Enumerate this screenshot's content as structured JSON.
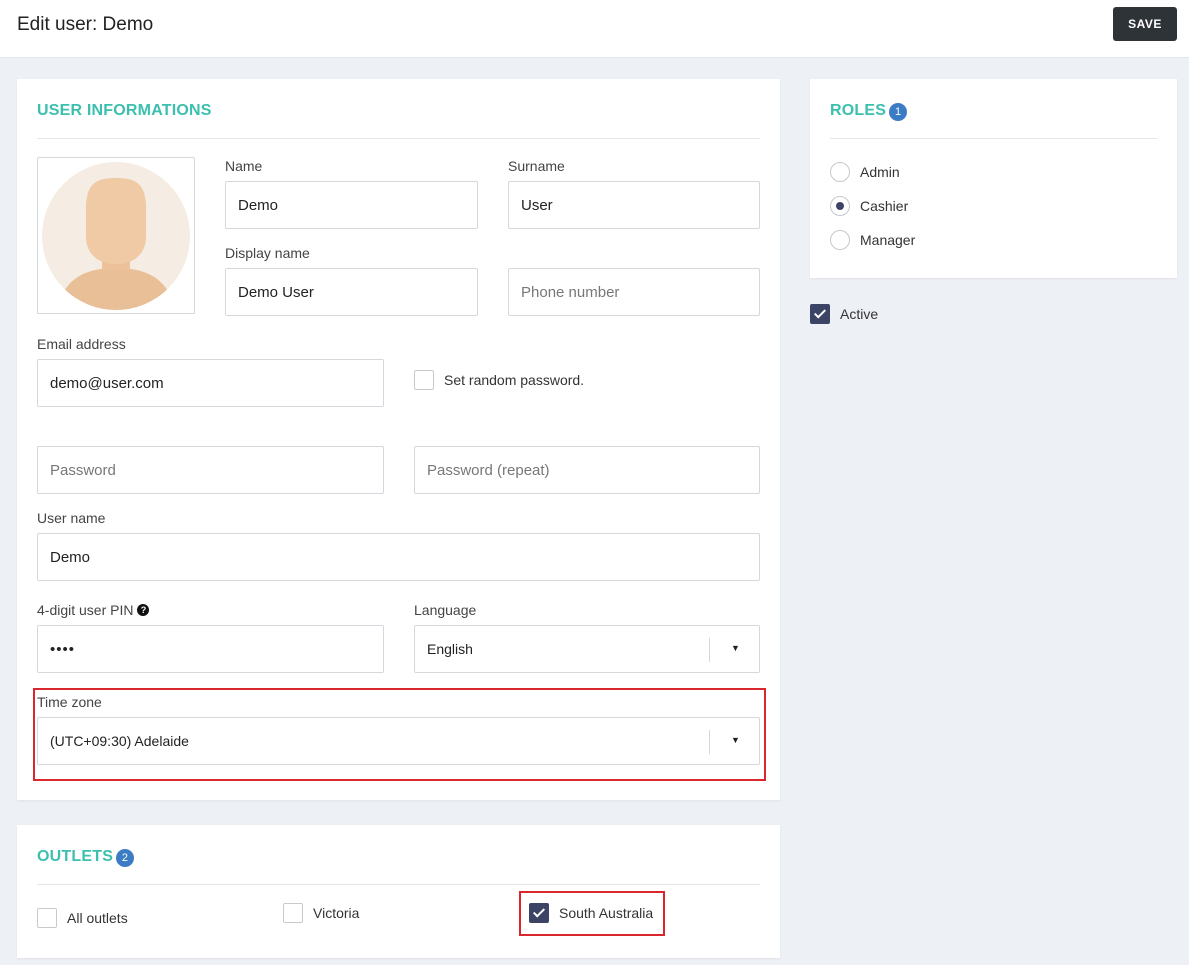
{
  "header": {
    "title": "Edit user: Demo",
    "save_label": "SAVE"
  },
  "user_info": {
    "title": "USER INFORMATIONS",
    "name": {
      "label": "Name",
      "value": "Demo"
    },
    "surname": {
      "label": "Surname",
      "value": "User"
    },
    "display_name": {
      "label": "Display name",
      "value": "Demo User"
    },
    "phone": {
      "placeholder": "Phone number",
      "value": ""
    },
    "email": {
      "label": "Email address",
      "value": "demo@user.com"
    },
    "random_password": {
      "label": "Set random password.",
      "checked": false
    },
    "password": {
      "placeholder": "Password"
    },
    "password_repeat": {
      "placeholder": "Password (repeat)"
    },
    "username": {
      "label": "User name",
      "value": "Demo"
    },
    "pin": {
      "label": "4-digit user PIN",
      "value": "••••"
    },
    "language": {
      "label": "Language",
      "value": "English"
    },
    "timezone": {
      "label": "Time zone",
      "value": "(UTC+09:30) Adelaide"
    }
  },
  "outlets": {
    "title": "OUTLETS",
    "count": "2",
    "items": [
      {
        "label": "All outlets",
        "checked": false
      },
      {
        "label": "Victoria",
        "checked": false
      },
      {
        "label": "South Australia",
        "checked": true
      }
    ]
  },
  "roles": {
    "title": "ROLES",
    "count": "1",
    "items": [
      {
        "label": "Admin",
        "checked": false
      },
      {
        "label": "Cashier",
        "checked": true
      },
      {
        "label": "Manager",
        "checked": false
      }
    ]
  },
  "active": {
    "label": "Active",
    "checked": true
  },
  "colors": {
    "accent": "#3bbfae",
    "badge": "#3c7cc4",
    "checked": "#3b4465",
    "highlight": "#d9272e",
    "save": "#2e3338"
  },
  "icons": [
    "help-icon",
    "chevron-down-icon",
    "check-icon",
    "avatar-placeholder"
  ]
}
